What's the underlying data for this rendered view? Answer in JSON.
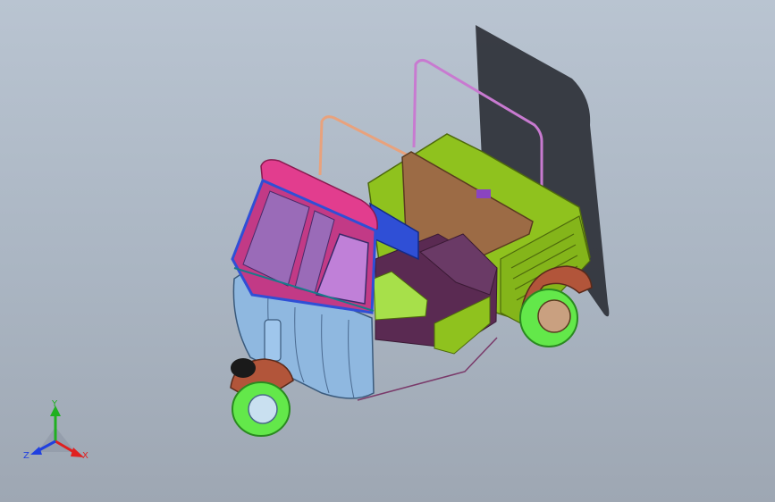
{
  "viewport": {
    "background_top": "#b9c4d1",
    "background_bottom": "#9ea7b3"
  },
  "model": {
    "name_icon": "auto-rickshaw-3d-model",
    "colors": {
      "cabin_roof": "#e23d8e",
      "windshield": "#9a6bb8",
      "front_body": "#8fb8e0",
      "chassis_green": "#8fc21e",
      "seat_brown": "#9c6b45",
      "tire_green": "#63e84a",
      "fender_brown": "#b2553a",
      "shadow": "#2e3138",
      "headlight_blue": "#2f4fd6"
    }
  },
  "triad": {
    "x_label": "X",
    "y_label": "Y",
    "z_label": "Z",
    "x_color": "#e02020",
    "y_color": "#20b020",
    "z_color": "#2040e0"
  }
}
